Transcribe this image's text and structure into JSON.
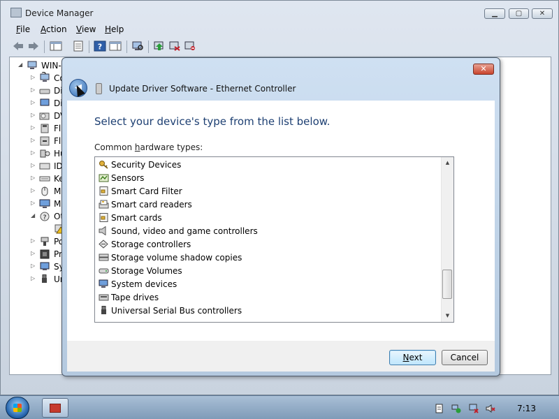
{
  "window": {
    "title": "Device Manager",
    "menu": [
      {
        "label": "File",
        "mnemonic": "F",
        "rest": "ile"
      },
      {
        "label": "Action",
        "mnemonic": "A",
        "rest": "ction"
      },
      {
        "label": "View",
        "mnemonic": "V",
        "rest": "iew"
      },
      {
        "label": "Help",
        "mnemonic": "H",
        "rest": "elp"
      }
    ],
    "controls": {
      "minimize": "▁",
      "maximize": "▢",
      "close": "✕"
    },
    "toolbar": [
      "back-icon",
      "forward-icon",
      "show-hide-tree-icon",
      "properties-icon",
      "help-icon",
      "action-pane-icon",
      "scan-hardware-icon",
      "update-driver-icon",
      "disable-device-icon",
      "uninstall-device-icon"
    ]
  },
  "tree": {
    "root": "WIN-3",
    "items": [
      {
        "label": "Co",
        "icon": "computer-icon"
      },
      {
        "label": "Di",
        "icon": "disk-drive-icon"
      },
      {
        "label": "Di",
        "icon": "display-adapter-icon"
      },
      {
        "label": "DV",
        "icon": "dvd-drive-icon"
      },
      {
        "label": "Fl",
        "icon": "floppy-controller-icon"
      },
      {
        "label": "Fl",
        "icon": "floppy-drive-icon"
      },
      {
        "label": "Hu",
        "icon": "human-interface-icon"
      },
      {
        "label": "ID",
        "icon": "ide-controller-icon"
      },
      {
        "label": "Ke",
        "icon": "keyboard-icon"
      },
      {
        "label": "M",
        "icon": "mouse-icon"
      },
      {
        "label": "M",
        "icon": "monitor-icon"
      },
      {
        "label": "Ot",
        "icon": "other-devices-icon"
      },
      {
        "label": "",
        "icon": "warning-device-icon"
      },
      {
        "label": "Po",
        "icon": "ports-icon"
      },
      {
        "label": "Pr",
        "icon": "processor-icon"
      },
      {
        "label": "Sy",
        "icon": "system-devices-icon"
      },
      {
        "label": "Ur",
        "icon": "usb-icon"
      }
    ]
  },
  "dialog": {
    "title": "Update Driver Software - Ethernet Controller",
    "close_glyph": "✕",
    "back_glyph": "◀",
    "heading": "Select your device's type from the list below.",
    "list_label_before": "Common ",
    "list_label_mnemonic": "h",
    "list_label_after": "ardware types:",
    "hardware_types": [
      {
        "label": "Security Devices",
        "icon": "key-icon"
      },
      {
        "label": "Sensors",
        "icon": "sensor-icon"
      },
      {
        "label": "Smart Card Filter",
        "icon": "smart-card-icon"
      },
      {
        "label": "Smart card readers",
        "icon": "card-reader-icon"
      },
      {
        "label": "Smart cards",
        "icon": "smart-card-icon"
      },
      {
        "label": "Sound, video and game controllers",
        "icon": "speaker-icon"
      },
      {
        "label": "Storage controllers",
        "icon": "storage-controller-icon"
      },
      {
        "label": "Storage volume shadow copies",
        "icon": "shadow-copy-icon"
      },
      {
        "label": "Storage Volumes",
        "icon": "volume-icon"
      },
      {
        "label": "System devices",
        "icon": "system-device-icon"
      },
      {
        "label": "Tape drives",
        "icon": "tape-drive-icon"
      },
      {
        "label": "Universal Serial Bus controllers",
        "icon": "usb-icon"
      }
    ],
    "scroll_position": 0.9,
    "buttons": {
      "next": {
        "mnemonic": "N",
        "rest": "ext"
      },
      "cancel": "Cancel"
    }
  },
  "taskbar": {
    "tray_icons": [
      "action-center-icon",
      "network-icon",
      "display-icon",
      "volume-muted-icon"
    ],
    "clock": "7:13"
  }
}
